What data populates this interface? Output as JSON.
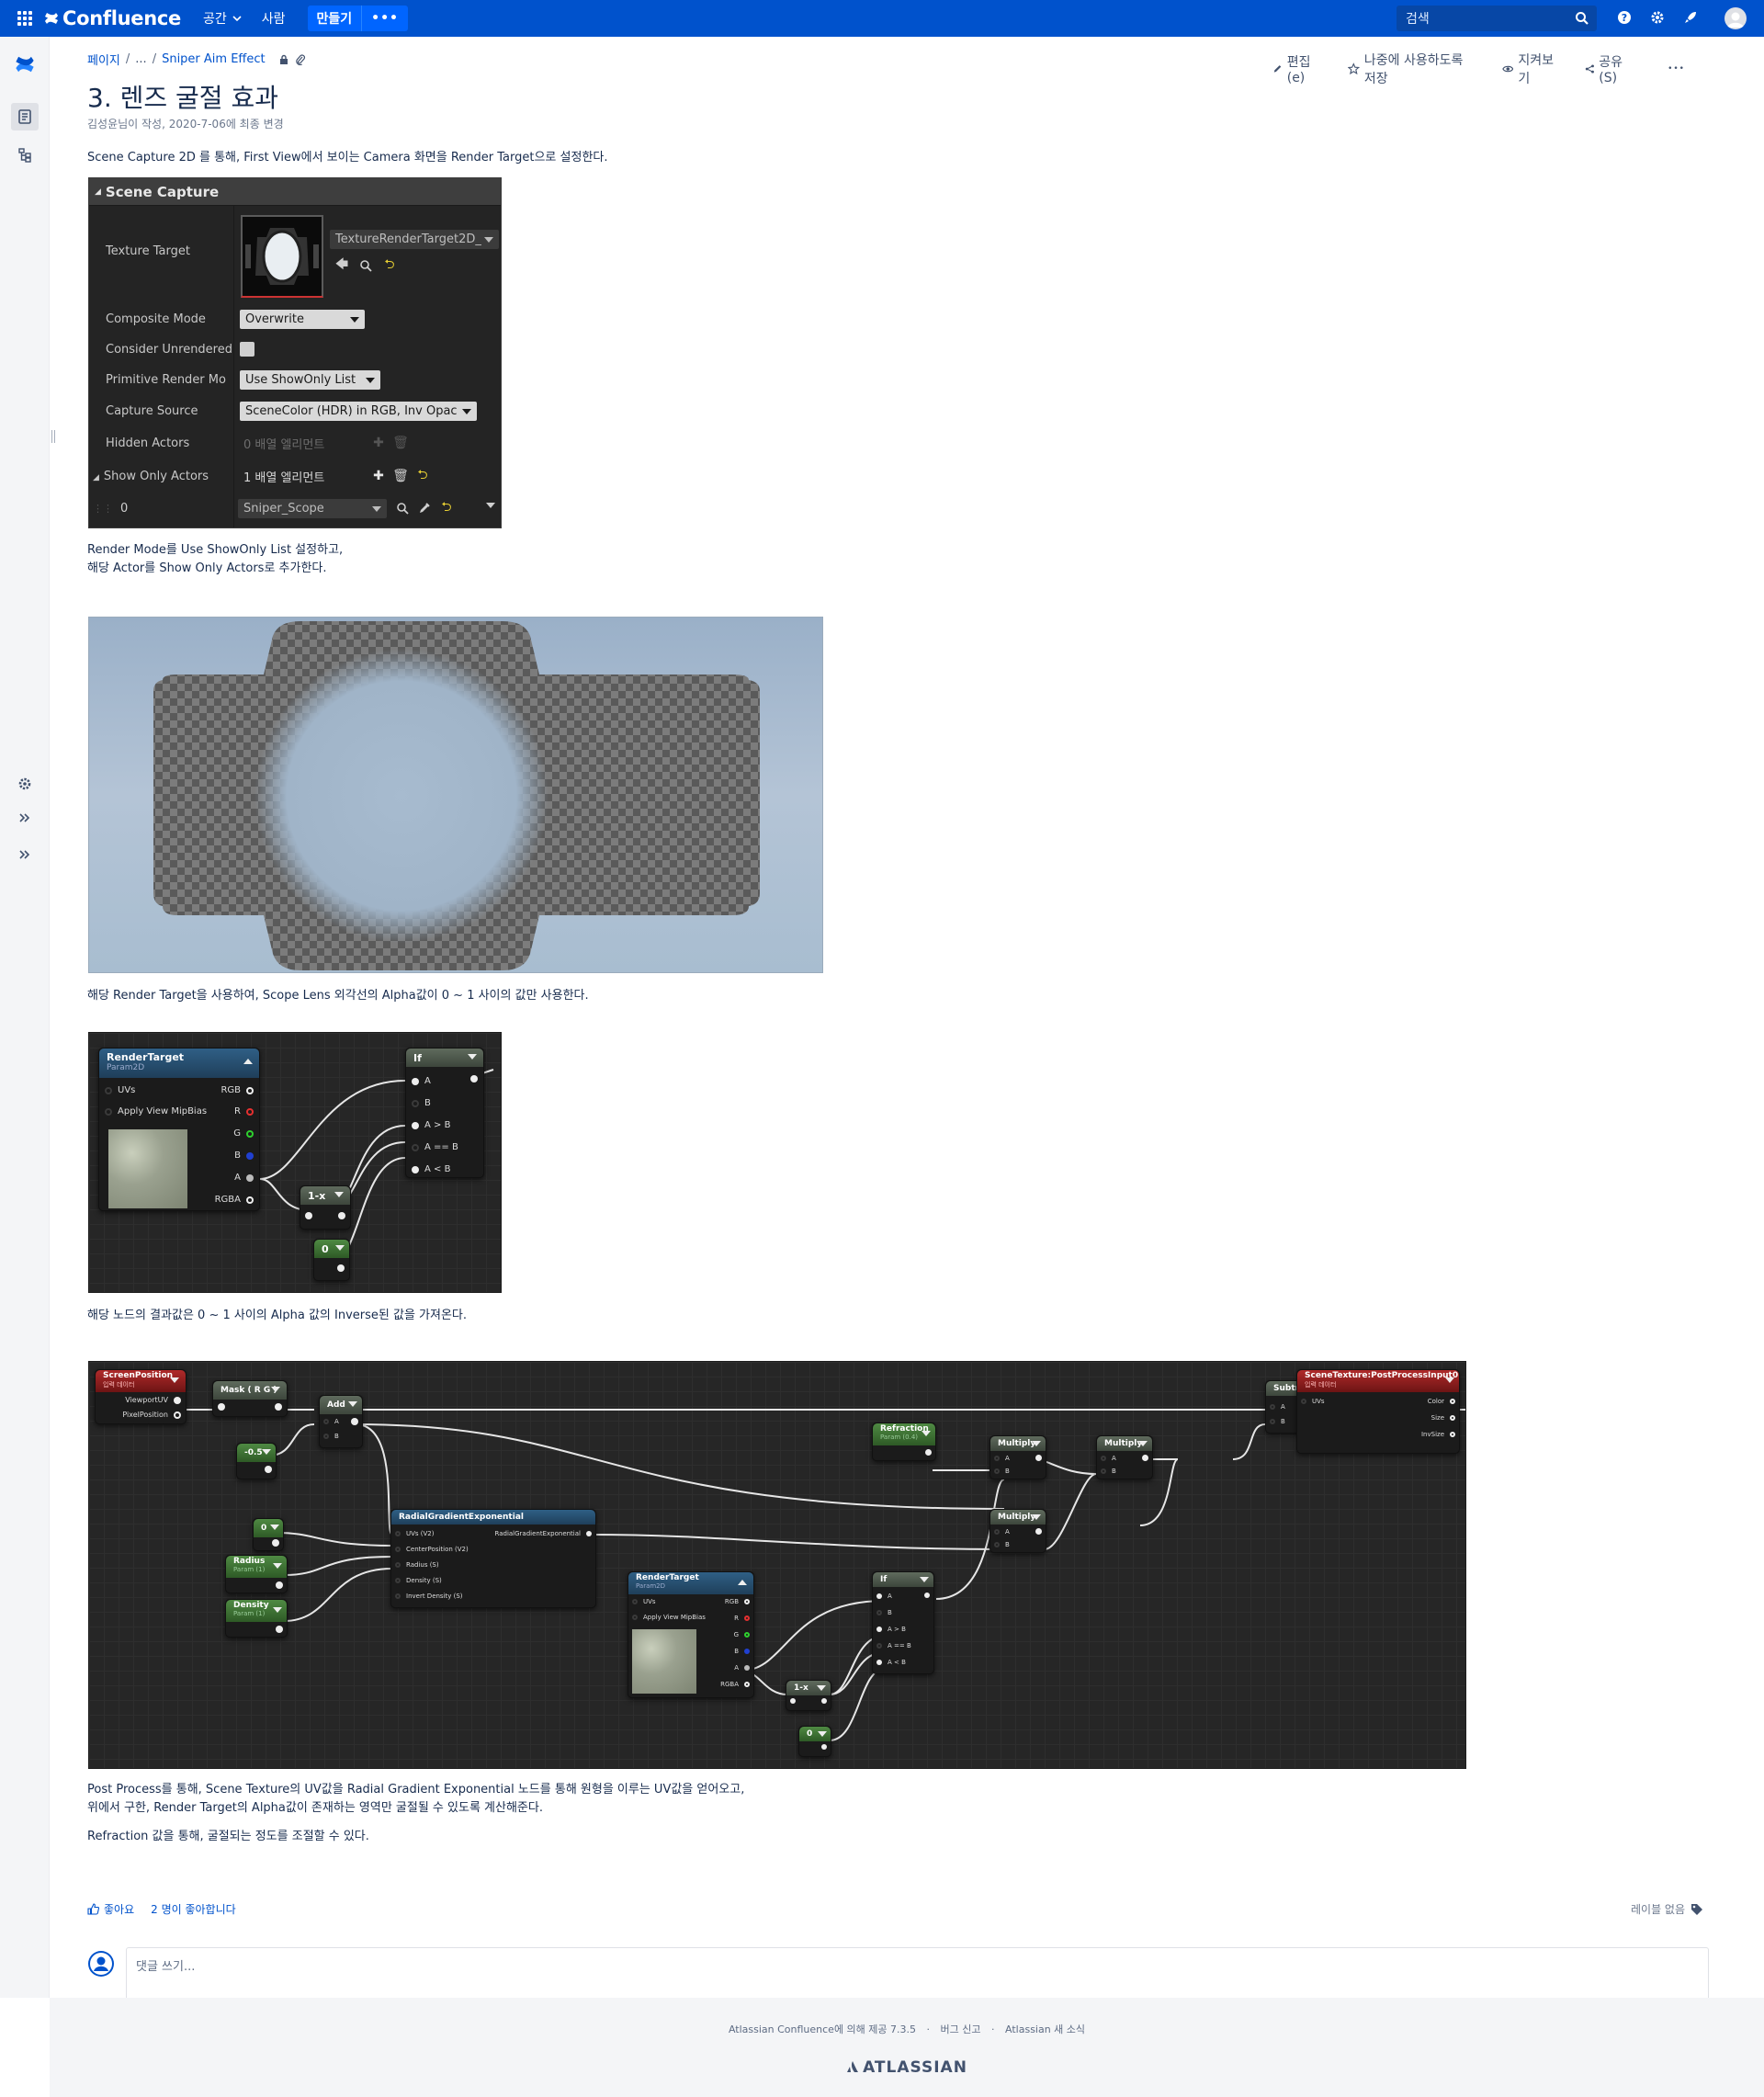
{
  "topnav": {
    "product": "Confluence",
    "spaces_label": "공간",
    "people_label": "사람",
    "create_label": "만들기",
    "more_label": "•••",
    "search_placeholder": "검색"
  },
  "breadcrumb": {
    "root": "페이지",
    "ellipsis": "...",
    "parent": "Sniper Aim Effect"
  },
  "page_actions": {
    "edit": "편집(e)",
    "save_later": "나중에 사용하도록 저장",
    "watch": "지켜보기",
    "share": "공유(S)",
    "more": "•••"
  },
  "page": {
    "title": "3. 렌즈 굴절 효과",
    "byline": "김성윤님이 작성, 2020-7-06에 최종 변경",
    "p1": "Scene Capture 2D 를 통해, First View에서 보이는 Camera 화면을 Render Target으로 설정한다.",
    "p2a": "Render Mode를 Use ShowOnly List 설정하고,",
    "p2b": "해당 Actor를 Show Only Actors로 추가한다.",
    "p3": "해당 Render Target을 사용하여, Scope Lens 외각선의 Alpha값이 0 ~ 1 사이의 값만 사용한다.",
    "p4": "해당 노드의 결과값은 0 ~ 1 사이의 Alpha 값의 Inverse된 값을 가져온다.",
    "p5a": "Post Process를 통해, Scene Texture의 UV값을 Radial Gradient Exponential 노드를 통해 원형을 이루는 UV값을 얻어오고,",
    "p5b": "위에서 구한, Render Target의 Alpha값이 존재하는 영역만 굴절될 수 있도록 계산해준다.",
    "p6": "Refraction 값을 통해, 굴절되는 정도를 조절할 수 있다."
  },
  "ue_panel": {
    "section": "Scene Capture",
    "texture_target_label": "Texture Target",
    "texture_target_value": "TextureRenderTarget2D_",
    "composite_mode_label": "Composite Mode",
    "composite_mode_value": "Overwrite",
    "consider_unrendered_label": "Consider Unrendered",
    "primitive_render_label": "Primitive Render Mo",
    "primitive_render_value": "Use ShowOnly List",
    "capture_source_label": "Capture Source",
    "capture_source_value": "SceneColor (HDR) in RGB, Inv Opac",
    "hidden_actors_label": "Hidden Actors",
    "hidden_actors_value": "0 배열 엘리먼트",
    "show_only_label": "Show Only Actors",
    "show_only_value": "1 배열 엘리먼트",
    "index_label": "0",
    "actor_value": "Sniper_Scope"
  },
  "graph1": {
    "rt_title": "RenderTarget",
    "rt_sub": "Param2D",
    "uvs": "UVs",
    "mip": "Apply View MipBias",
    "rgb": "RGB",
    "r": "R",
    "g": "G",
    "b": "B",
    "a": "A",
    "rgba": "RGBA",
    "if_title": "If",
    "pin_a": "A",
    "pin_b": "B",
    "a_gt_b": "A > B",
    "a_eq_b": "A == B",
    "a_lt_b": "A < B",
    "oneminus": "1-x",
    "zero": "0"
  },
  "graph2": {
    "screenpos": "ScreenPosition",
    "screenpos_sub": "입력 데이터",
    "viewportuv": "ViewportUV",
    "pixelpos": "PixelPosition",
    "mask": "Mask ( R G )",
    "add": "Add",
    "neg": "-0.5",
    "zero": "0",
    "radius": "Radius",
    "radius_sub": "Param (1)",
    "density": "Density",
    "density_sub": "Param (1)",
    "rge": "RadialGradientExponential",
    "rge_uvs": "UVs (V2)",
    "rge_center": "CenterPosition (V2)",
    "rge_radius": "Radius (S)",
    "rge_density": "Density (S)",
    "rge_invert": "Invert Density (S)",
    "rge_out": "RadialGradientExponential",
    "rt_title": "RenderTarget",
    "rt_sub": "Param2D",
    "uvs": "UVs",
    "mip": "Apply View MipBias",
    "rgb": "RGB",
    "r": "R",
    "g": "G",
    "b": "B",
    "a": "A",
    "rgba": "RGBA",
    "oneminus": "1-x",
    "zero2": "0",
    "if_title": "If",
    "pin_a": "A",
    "pin_b": "B",
    "a_gt_b": "A > B",
    "a_eq_b": "A == B",
    "a_lt_b": "A < B",
    "refraction": "Refraction",
    "refraction_sub": "Param (0.4)",
    "multiply": "Multiply",
    "subtract": "Subtract",
    "scenetex": "SceneTexture:PostProcessInput0",
    "scenetex_sub": "입력 데이터",
    "st_uvs": "UVs",
    "st_color": "Color",
    "st_size": "Size",
    "st_invsize": "InvSize"
  },
  "footer": {
    "like": "좋아요",
    "like_count": "2 명이 좋아합니다",
    "labels": "레이블 없음",
    "comment_placeholder": "댓글 쓰기...",
    "powered": "Atlassian Confluence에 의해 제공 7.3.5",
    "bug": "버그 신고",
    "news": "Atlassian 새 소식",
    "brand": "ATLASSIAN"
  }
}
